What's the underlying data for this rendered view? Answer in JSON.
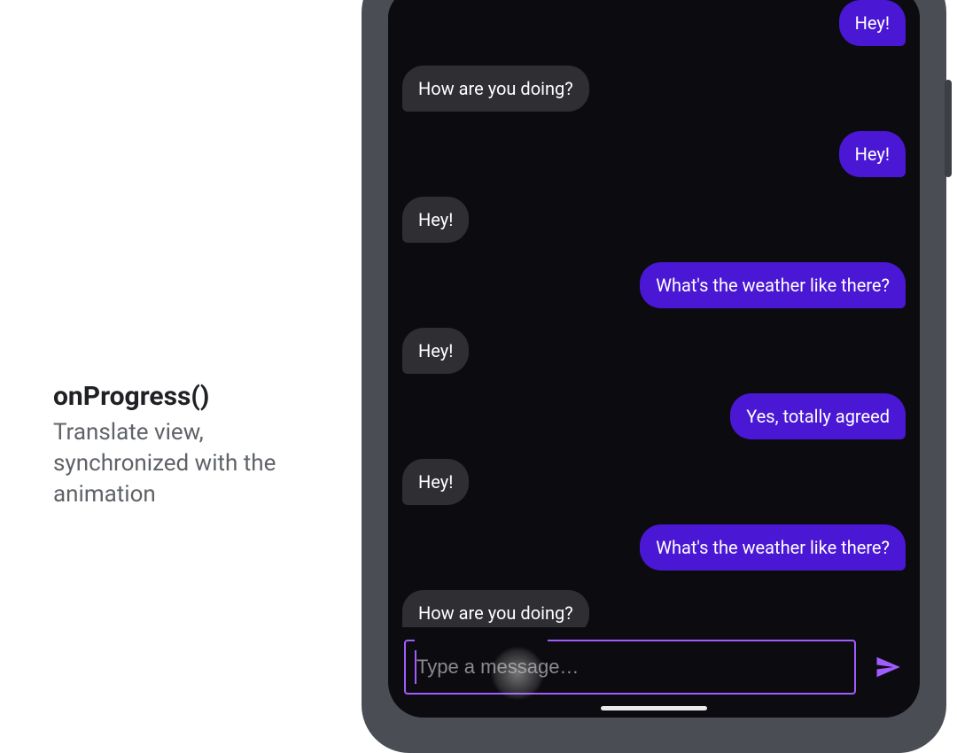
{
  "caption": {
    "title": "onProgress()",
    "desc": "Translate view, synchronized with the animation"
  },
  "colors": {
    "accent": "#a05cff",
    "outgoing_bubble": "#4a17d4",
    "incoming_bubble": "#2e2e33",
    "screen_bg": "#0c0c10"
  },
  "chat": {
    "messages": [
      {
        "side": "right",
        "text": "Hey!"
      },
      {
        "side": "left",
        "text": "How are you doing?"
      },
      {
        "side": "right",
        "text": "Hey!"
      },
      {
        "side": "left",
        "text": "Hey!"
      },
      {
        "side": "right",
        "text": "What's the weather like there?"
      },
      {
        "side": "left",
        "text": "Hey!"
      },
      {
        "side": "right",
        "text": "Yes, totally agreed"
      },
      {
        "side": "left",
        "text": "Hey!"
      },
      {
        "side": "right",
        "text": "What's the weather like there?"
      },
      {
        "side": "left",
        "text": "How are you doing?"
      }
    ],
    "composer": {
      "placeholder": "Type a message…",
      "value": ""
    }
  },
  "icons": {
    "send": "send-icon"
  }
}
